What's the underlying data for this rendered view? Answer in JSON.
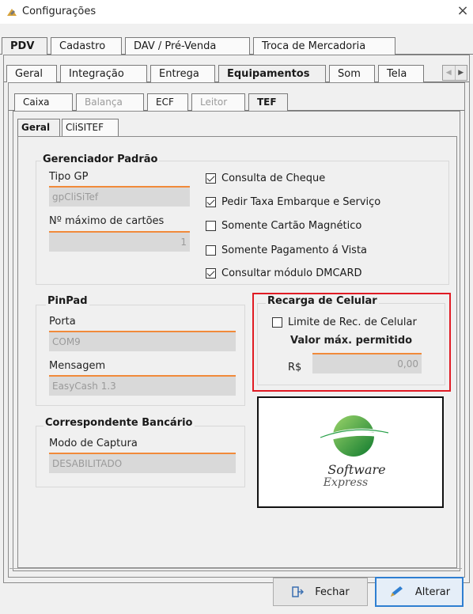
{
  "window": {
    "title": "Configurações",
    "close_glyph": "×"
  },
  "tabs_main": [
    {
      "label": "PDV",
      "selected": true
    },
    {
      "label": "Cadastro",
      "selected": false
    },
    {
      "label": "DAV / Pré-Venda",
      "selected": false
    },
    {
      "label": "Troca de Mercadoria",
      "selected": false
    }
  ],
  "tabs_pdv": [
    {
      "label": "Geral",
      "selected": false
    },
    {
      "label": "Integração",
      "selected": false
    },
    {
      "label": "Entrega",
      "selected": false
    },
    {
      "label": "Equipamentos",
      "selected": true
    },
    {
      "label": "Som",
      "selected": false
    },
    {
      "label": "Tela",
      "selected": false
    }
  ],
  "tabs_equip": [
    {
      "label": "Caixa",
      "selected": false,
      "disabled": false
    },
    {
      "label": "Balança",
      "selected": false,
      "disabled": true
    },
    {
      "label": "ECF",
      "selected": false,
      "disabled": false
    },
    {
      "label": "Leitor",
      "selected": false,
      "disabled": true
    },
    {
      "label": "TEF",
      "selected": true,
      "disabled": false
    }
  ],
  "tabs_tef": [
    {
      "label": "Geral",
      "selected": true
    },
    {
      "label": "CliSITEF",
      "selected": false
    }
  ],
  "gerenciador": {
    "title": "Gerenciador Padrão",
    "tipo_gp_label": "Tipo GP",
    "tipo_gp_value": "gpCliSiTef",
    "max_cartoes_label": "Nº máximo de cartões",
    "max_cartoes_value": "1",
    "checks": [
      {
        "label": "Consulta de Cheque",
        "checked": true
      },
      {
        "label": "Pedir Taxa Embarque e Serviço",
        "checked": true
      },
      {
        "label": "Somente Cartão Magnético",
        "checked": false
      },
      {
        "label": "Somente Pagamento á Vista",
        "checked": false
      },
      {
        "label": "Consultar módulo DMCARD",
        "checked": true
      }
    ]
  },
  "pinpad": {
    "title": "PinPad",
    "porta_label": "Porta",
    "porta_value": "COM9",
    "mensagem_label": "Mensagem",
    "mensagem_value": "EasyCash 1.3"
  },
  "recarga": {
    "title": "Recarga de Celular",
    "limite_label": "Limite de Rec. de Celular",
    "limite_checked": false,
    "valor_label": "Valor máx. permitido",
    "currency": "R$",
    "valor_value": "0,00"
  },
  "correspondente": {
    "title": "Correspondente Bancário",
    "modo_label": "Modo de Captura",
    "modo_value": "DESABILITADO"
  },
  "logo": {
    "line1": "Software",
    "line2": "Express",
    "color": "#1a8f3a"
  },
  "buttons": {
    "fechar": "Fechar",
    "alterar": "Alterar"
  },
  "colors": {
    "highlight_border": "#e01b24",
    "field_accent": "#f18a3a"
  }
}
